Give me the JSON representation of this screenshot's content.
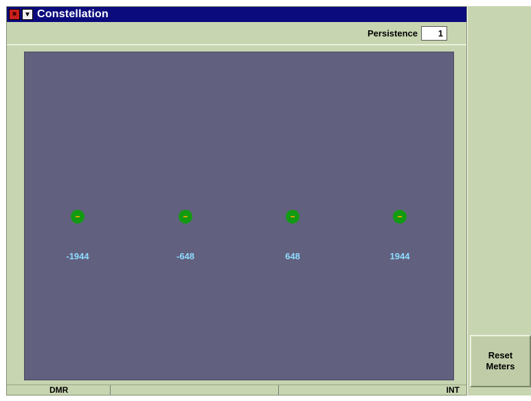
{
  "window": {
    "title": "Constellation",
    "sys_icon": "system-menu-icon",
    "menu_icon": "dropdown-triangle-icon"
  },
  "toolbar": {
    "persistence_label": "Persistence",
    "persistence_value": "1"
  },
  "plot": {
    "background_color": "#62607f",
    "point_color": "#139a13",
    "label_color": "#8fdcff",
    "symbols": [
      {
        "label": "-1944"
      },
      {
        "label": "-648"
      },
      {
        "label": "648"
      },
      {
        "label": "1944"
      }
    ]
  },
  "status": {
    "mode": "DMR",
    "middle": "",
    "middle2": "",
    "source": "INT"
  },
  "side": {
    "reset_button": "Reset\nMeters"
  }
}
